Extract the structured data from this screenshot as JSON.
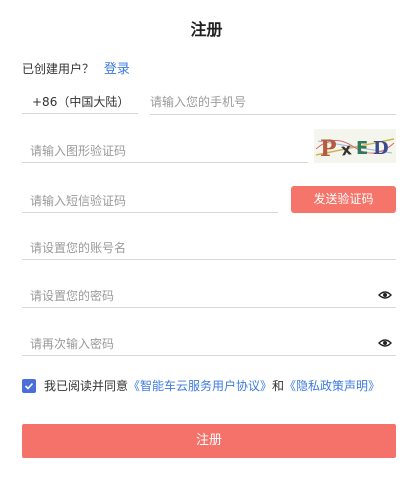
{
  "page": {
    "title": "注册"
  },
  "login_prompt": {
    "text": "已创建用户？",
    "link": "登录"
  },
  "phone": {
    "country_code": "+86（中国大陆）",
    "placeholder": "请输入您的手机号"
  },
  "captcha": {
    "placeholder": "请输入图形验证码",
    "image_text": "PxED"
  },
  "sms": {
    "placeholder": "请输入短信验证码",
    "button_label": "发送验证码"
  },
  "account": {
    "placeholder": "请设置您的账号名"
  },
  "password": {
    "placeholder": "请设置您的密码",
    "icon": "eye-icon"
  },
  "password_confirm": {
    "placeholder": "请再次输入密码",
    "icon": "eye-icon"
  },
  "agreement": {
    "checked": true,
    "prefix": "我已阅读并同意",
    "user_agreement": "《智能车云服务用户协议》",
    "conjunction": "和",
    "privacy": "《隐私政策声明》"
  },
  "submit": {
    "label": "注册"
  },
  "colors": {
    "primary": "#f5726a",
    "link": "#3d7be0",
    "checkbox": "#4a6fd8"
  }
}
